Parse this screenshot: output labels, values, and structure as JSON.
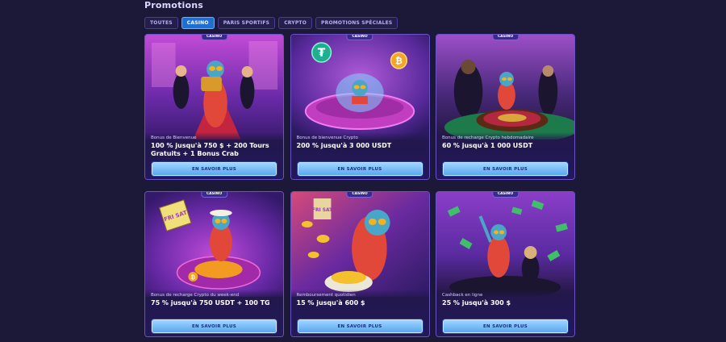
{
  "page": {
    "title": "Promotions"
  },
  "tabs": [
    {
      "label": "TOUTES",
      "active": false
    },
    {
      "label": "CASINO",
      "active": true
    },
    {
      "label": "PARIS SPORTIFS",
      "active": false
    },
    {
      "label": "CRYPTO",
      "active": false
    },
    {
      "label": "PROMOTIONS SPÉCIALES",
      "active": false
    }
  ],
  "cards": [
    {
      "badge": "CASINO",
      "subtitle": "Bonus de Bienvenue",
      "title": "100 % jusqu'à 750 $ + 200 Tours Gratuits + 1 Bonus Crab",
      "cta": "EN SAVOIR PLUS"
    },
    {
      "badge": "CASINO",
      "subtitle": "Bonus de bienvenue Crypto",
      "title": "200 % jusqu'à 3 000 USDT",
      "cta": "EN SAVOIR PLUS"
    },
    {
      "badge": "CASINO",
      "subtitle": "Bonus de recharge Crypto hebdomadaire",
      "title": "60 % jusqu'à 1 000 USDT",
      "cta": "EN SAVOIR PLUS"
    },
    {
      "badge": "CASINO",
      "subtitle": "Bonus de recharge Crypto du week-end",
      "title": "75 % jusqu'à 750 USDT + 100 TG",
      "cta": "EN SAVOIR PLUS"
    },
    {
      "badge": "CASINO",
      "subtitle": "Remboursement quotidien",
      "title": "15 % jusqu'à 600 $",
      "cta": "EN SAVOIR PLUS"
    },
    {
      "badge": "CASINO",
      "subtitle": "Cashback en ligne",
      "title": "25 % jusqu'à 300 $",
      "cta": "EN SAVOIR PLUS"
    }
  ],
  "art_labels": {
    "card2_tether": "₮",
    "card2_bitcoin": "₿",
    "card4_sign": "FRI SAT",
    "card4_bitcoin": "₿",
    "card5_sign": "FRI SAT"
  },
  "colors": {
    "background": "#1c1838",
    "tab_active": "#1f6fd1",
    "card_border": "#6b52c9",
    "cta": "#7ec0ff"
  }
}
